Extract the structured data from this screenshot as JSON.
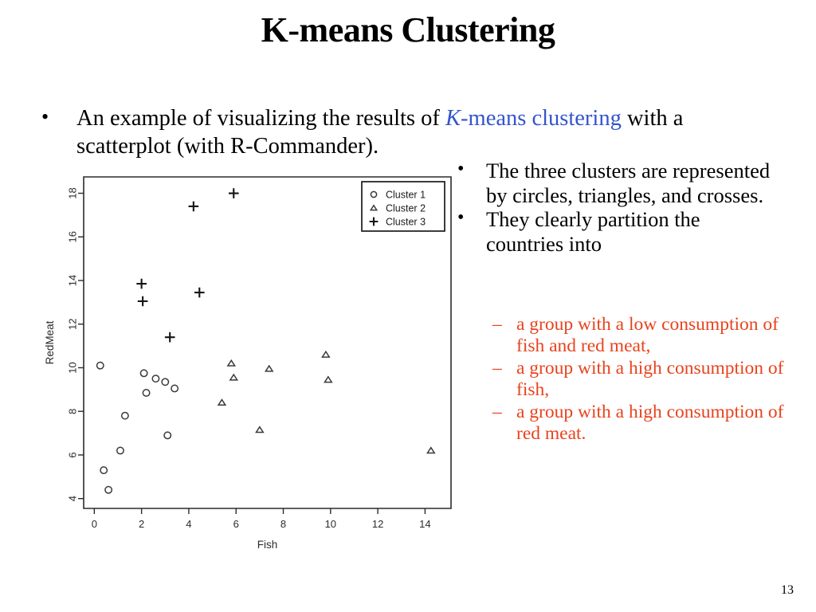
{
  "slide": {
    "title": "K-means Clustering",
    "page_number": "13",
    "accent_blue": "#3355cc",
    "accent_orange": "#e8431d"
  },
  "main_bullet": {
    "marker": "•",
    "text_before": "An example of visualizing the results of ",
    "highlight_italic": "K",
    "highlight_rest": "-means clustering",
    "text_after": " with a scatterplot (with R-Commander)."
  },
  "right_bullets": [
    {
      "marker": "•",
      "text": "The three clusters are represented by circles, triangles, and crosses."
    },
    {
      "marker": "•",
      "text": "They clearly partition the countries into"
    }
  ],
  "sub_bullets": [
    {
      "marker": "–",
      "text": "a group with a low consumption of fish and red meat,"
    },
    {
      "marker": "–",
      "text": "a group with a high consumption of fish,"
    },
    {
      "marker": "–",
      "text": "a group with a high consumption of red meat."
    }
  ],
  "chart_data": {
    "type": "scatter",
    "title": "",
    "xlabel": "Fish",
    "ylabel": "RedMeat",
    "xlim": [
      -0.45,
      15.1
    ],
    "ylim": [
      3.55,
      18.75
    ],
    "xticks": [
      0,
      2,
      4,
      6,
      8,
      10,
      12,
      14
    ],
    "xtick_labels": [
      "0",
      "2",
      "4",
      "6",
      "8",
      "10",
      "12",
      "14"
    ],
    "yticks": [
      4,
      6,
      8,
      10,
      12,
      14,
      16,
      18
    ],
    "ytick_labels": [
      "4",
      "6",
      "8",
      "10",
      "12",
      "14",
      "16",
      "18"
    ],
    "grid": false,
    "legend_position": "top-right",
    "legend": [
      {
        "label": "Cluster 1",
        "marker": "circle"
      },
      {
        "label": "Cluster 2",
        "marker": "triangle"
      },
      {
        "label": "Cluster 3",
        "marker": "plus"
      }
    ],
    "series": [
      {
        "name": "Cluster 1",
        "marker": "circle",
        "points": [
          [
            0.25,
            10.1
          ],
          [
            0.4,
            5.3
          ],
          [
            0.6,
            4.4
          ],
          [
            1.1,
            6.2
          ],
          [
            1.3,
            7.8
          ],
          [
            2.1,
            9.75
          ],
          [
            2.2,
            8.85
          ],
          [
            2.6,
            9.5
          ],
          [
            3.0,
            9.35
          ],
          [
            3.1,
            6.9
          ],
          [
            3.4,
            9.05
          ]
        ]
      },
      {
        "name": "Cluster 2",
        "marker": "triangle",
        "points": [
          [
            5.4,
            8.4
          ],
          [
            5.8,
            10.2
          ],
          [
            5.9,
            9.55
          ],
          [
            7.0,
            7.15
          ],
          [
            7.4,
            9.95
          ],
          [
            9.8,
            10.6
          ],
          [
            9.9,
            9.45
          ],
          [
            14.25,
            6.2
          ]
        ]
      },
      {
        "name": "Cluster 3",
        "marker": "plus",
        "points": [
          [
            2.0,
            13.85
          ],
          [
            2.05,
            13.05
          ],
          [
            3.2,
            11.4
          ],
          [
            4.45,
            13.45
          ],
          [
            4.2,
            17.4
          ],
          [
            5.9,
            18.0
          ]
        ]
      }
    ]
  }
}
